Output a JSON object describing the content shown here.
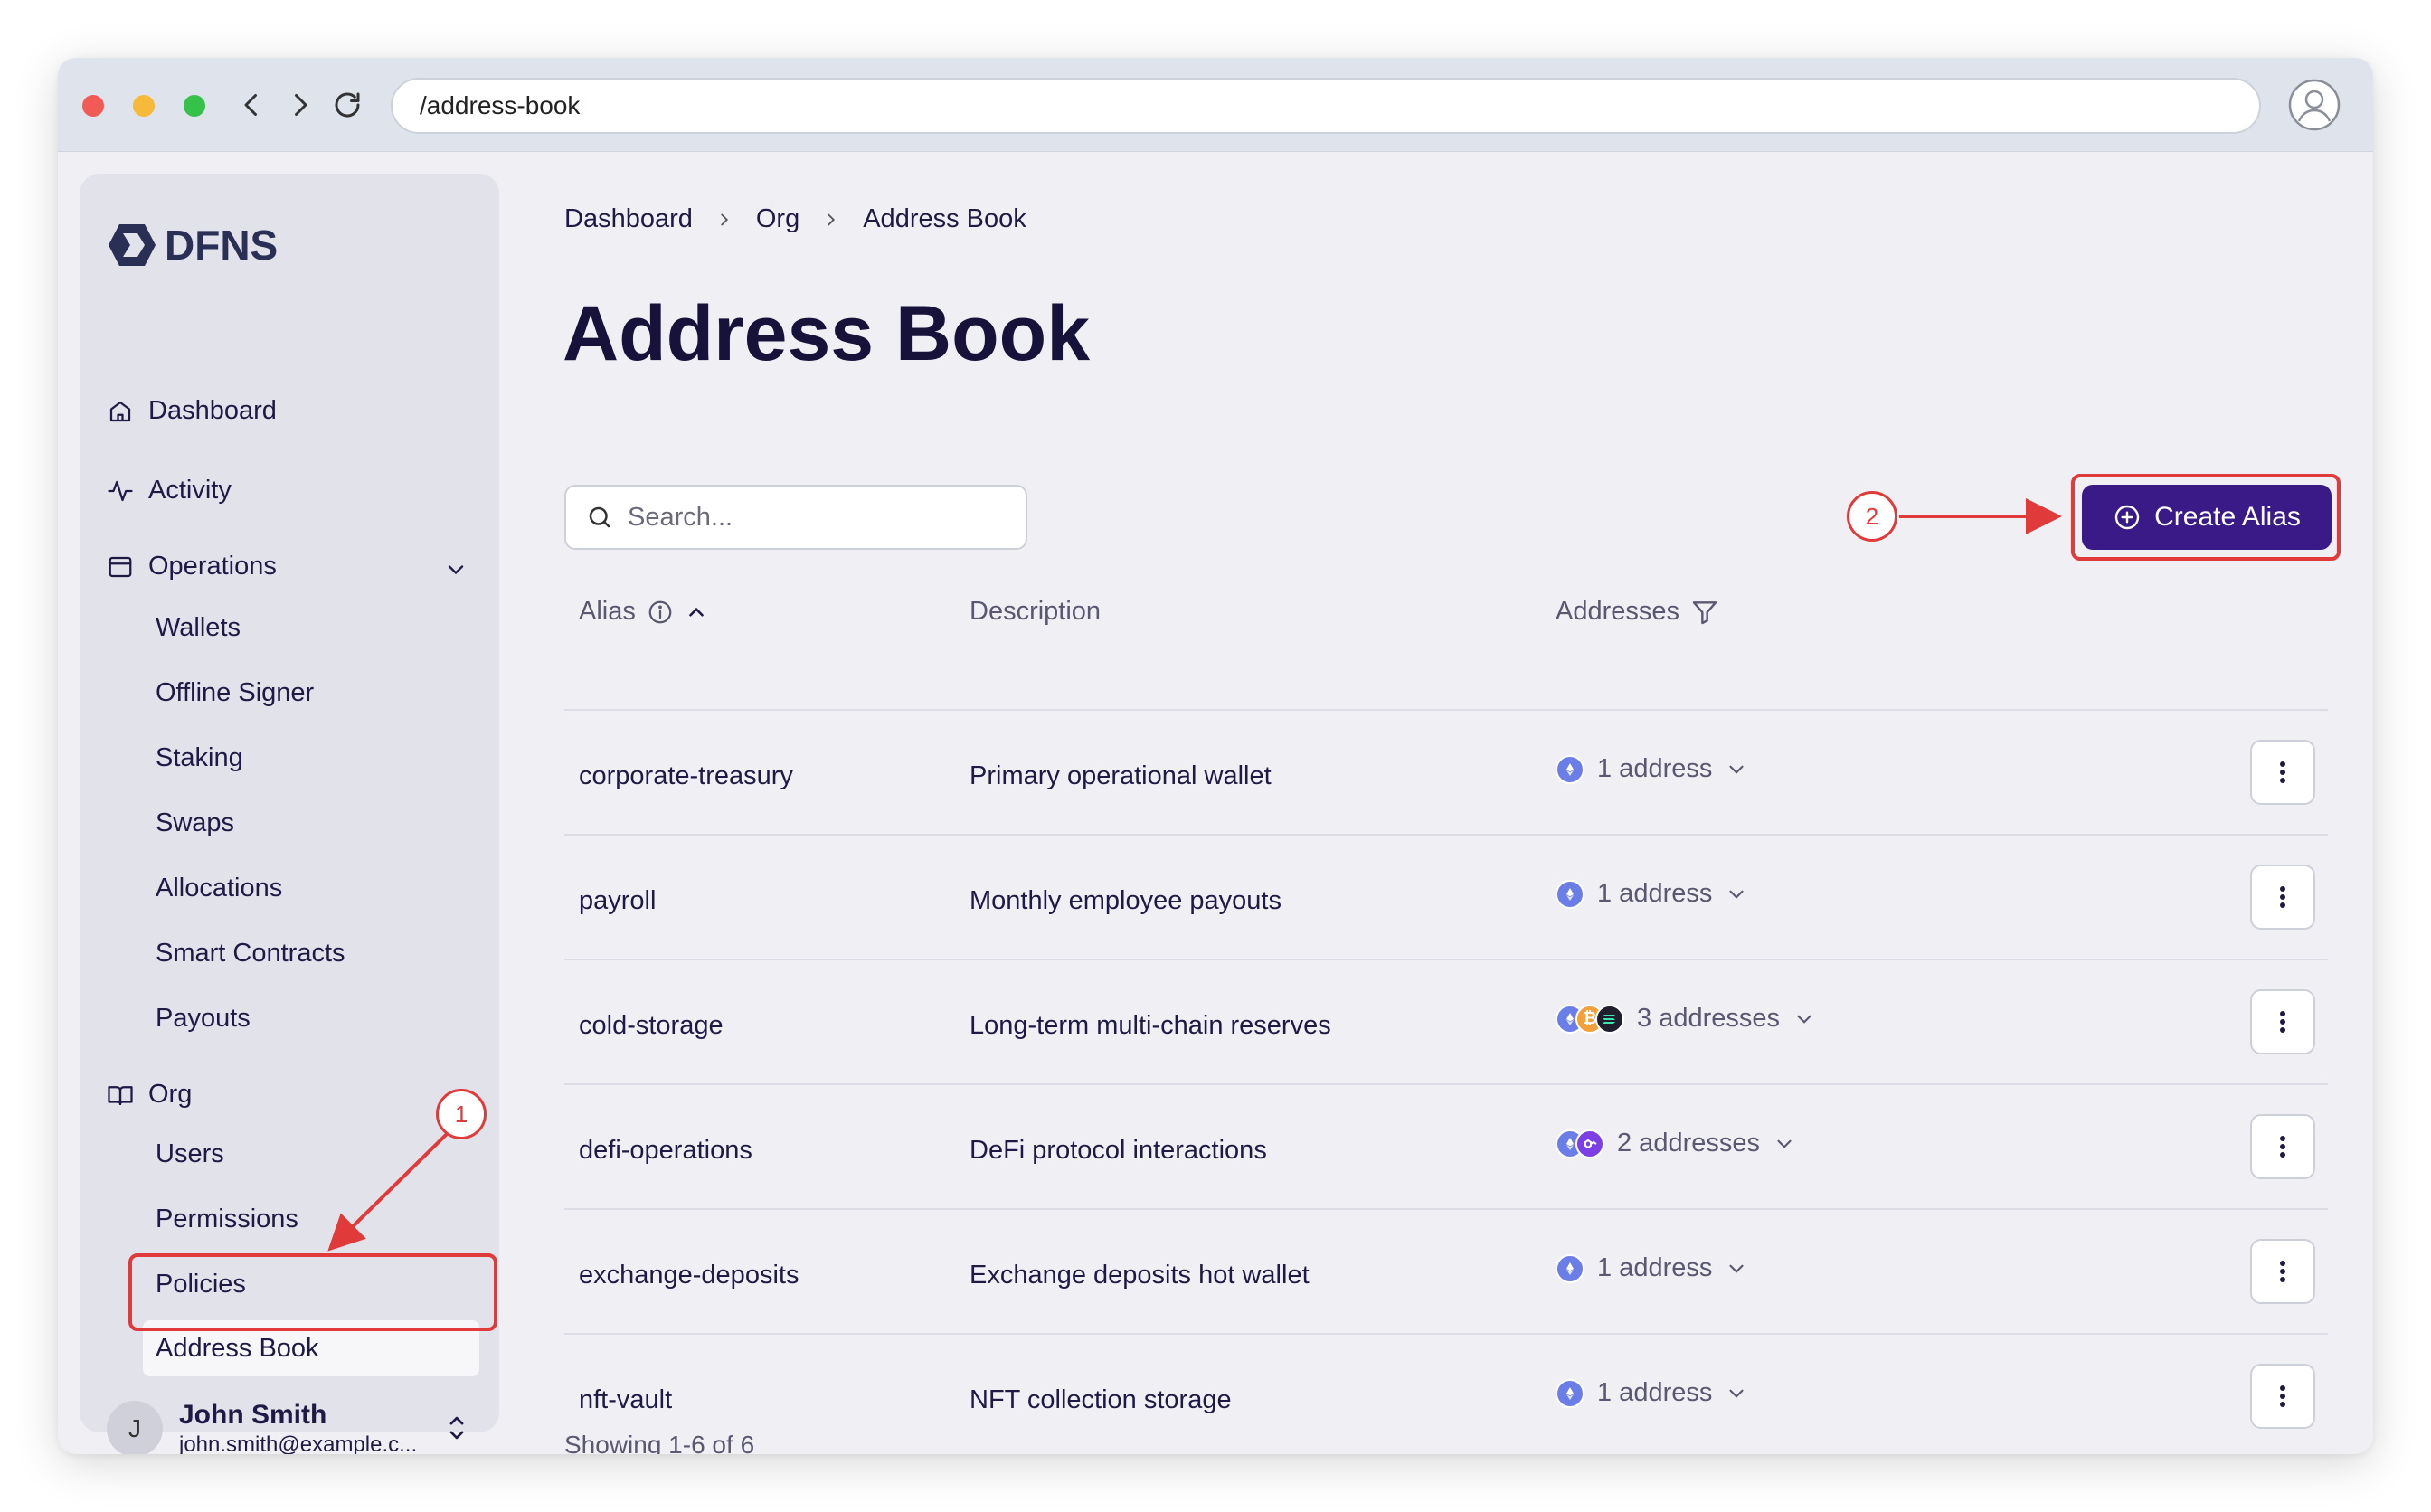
{
  "browser": {
    "url": "/address-book"
  },
  "sidebar": {
    "logo": "DFNS",
    "nav": {
      "dashboard": "Dashboard",
      "activity": "Activity",
      "operations": "Operations",
      "org": "Org"
    },
    "operations_items": [
      "Wallets",
      "Offline Signer",
      "Staking",
      "Swaps",
      "Allocations",
      "Smart Contracts",
      "Payouts"
    ],
    "org_items": [
      "Users",
      "Permissions",
      "Policies",
      "Address Book"
    ],
    "user": {
      "initial": "J",
      "name": "John Smith",
      "email": "john.smith@example.c..."
    }
  },
  "breadcrumb": [
    "Dashboard",
    "Org",
    "Address Book"
  ],
  "page": {
    "title": "Address Book",
    "search_placeholder": "Search...",
    "create_button": "Create Alias"
  },
  "table": {
    "headers": {
      "alias": "Alias",
      "description": "Description",
      "addresses": "Addresses"
    },
    "rows": [
      {
        "alias": "corporate-treasury",
        "description": "Primary operational wallet",
        "addresses": "1 address",
        "coins": [
          "eth"
        ]
      },
      {
        "alias": "payroll",
        "description": "Monthly employee payouts",
        "addresses": "1 address",
        "coins": [
          "eth"
        ]
      },
      {
        "alias": "cold-storage",
        "description": "Long-term multi-chain reserves",
        "addresses": "3 addresses",
        "coins": [
          "eth",
          "btc",
          "sol"
        ]
      },
      {
        "alias": "defi-operations",
        "description": "DeFi protocol interactions",
        "addresses": "2 addresses",
        "coins": [
          "eth",
          "polygon"
        ]
      },
      {
        "alias": "exchange-deposits",
        "description": "Exchange deposits hot wallet",
        "addresses": "1 address",
        "coins": [
          "eth"
        ]
      },
      {
        "alias": "nft-vault",
        "description": "NFT collection storage",
        "addresses": "1 address",
        "coins": [
          "eth"
        ]
      }
    ],
    "footer": "Showing 1-6 of 6"
  },
  "annotations": {
    "step1": "1",
    "step2": "2"
  },
  "colors": {
    "brand": "#3a1a86",
    "annotation": "#e03a3a",
    "eth": "#6b7ee8",
    "btc": "#f2a03a",
    "sol": "#1f1f2e",
    "polygon": "#7b3fe4"
  }
}
